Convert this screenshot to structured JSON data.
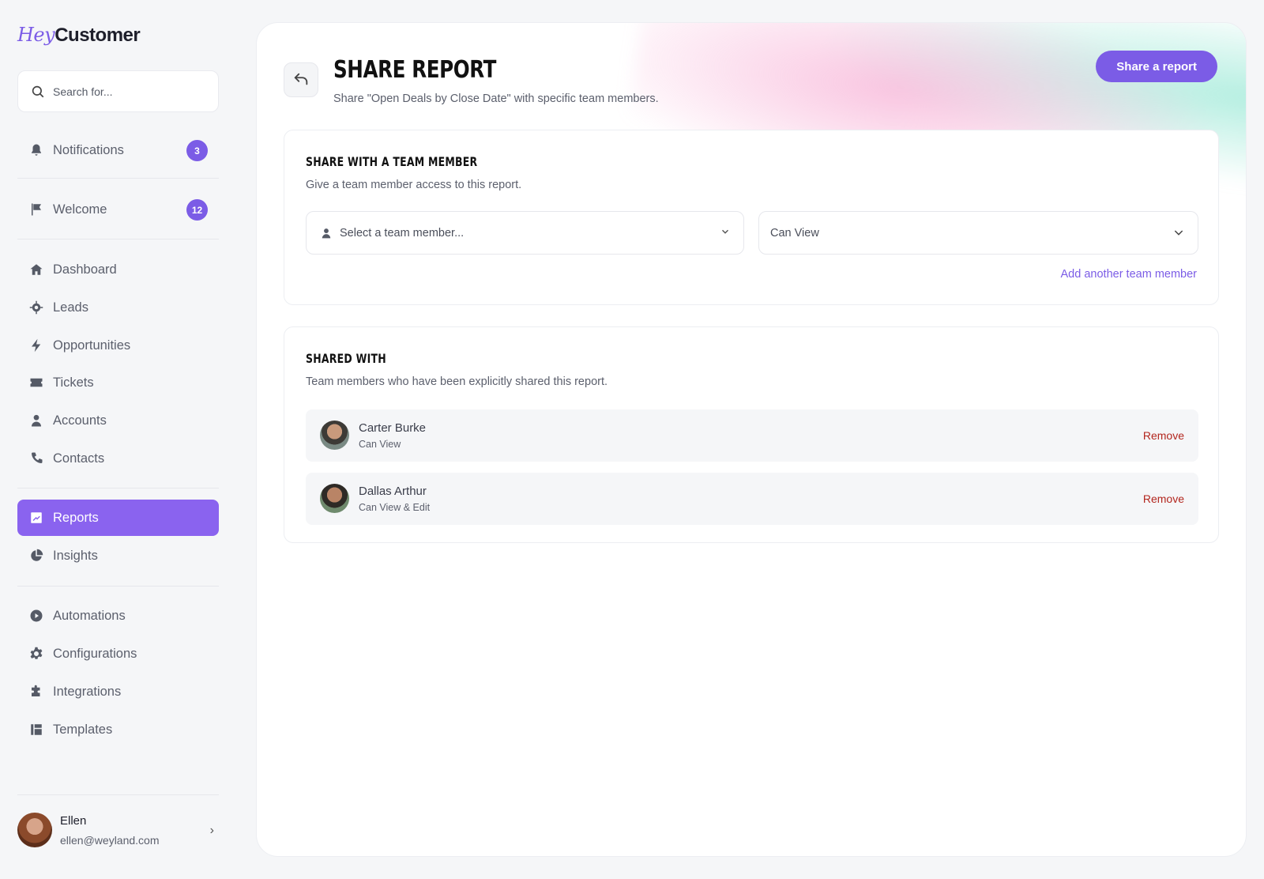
{
  "brand": {
    "prefix": "Hey",
    "name": "Customer"
  },
  "search": {
    "placeholder": "Search for..."
  },
  "sidebar": {
    "notifications": {
      "label": "Notifications",
      "badge": "3"
    },
    "welcome": {
      "label": "Welcome",
      "badge": "12"
    },
    "items": [
      {
        "label": "Dashboard",
        "icon": "home-icon"
      },
      {
        "label": "Leads",
        "icon": "target-icon"
      },
      {
        "label": "Opportunities",
        "icon": "bolt-icon"
      },
      {
        "label": "Tickets",
        "icon": "ticket-icon"
      },
      {
        "label": "Accounts",
        "icon": "user-icon"
      },
      {
        "label": "Contacts",
        "icon": "phone-icon"
      },
      {
        "label": "Reports",
        "icon": "chart-icon",
        "active": true
      },
      {
        "label": "Insights",
        "icon": "pie-icon"
      },
      {
        "label": "Automations",
        "icon": "play-icon"
      },
      {
        "label": "Configurations",
        "icon": "gear-icon"
      },
      {
        "label": "Integrations",
        "icon": "puzzle-icon"
      },
      {
        "label": "Templates",
        "icon": "template-icon"
      }
    ]
  },
  "user": {
    "name": "Ellen",
    "email": "ellen@weyland.com"
  },
  "header": {
    "title": "SHARE REPORT",
    "subtitle": "Share \"Open Deals by Close Date\" with specific team members.",
    "share_button": "Share a report"
  },
  "share_panel": {
    "title": "SHARE WITH A TEAM MEMBER",
    "description": "Give a team member access to this report.",
    "member_placeholder": "Select a team member...",
    "permission_value": "Can View",
    "add_link": "Add another team member"
  },
  "shared_panel": {
    "title": "SHARED WITH",
    "description": "Team members who have been explicitly shared this report.",
    "members": [
      {
        "name": "Carter Burke",
        "role": "Can View",
        "action": "Remove"
      },
      {
        "name": "Dallas Arthur",
        "role": "Can View & Edit",
        "action": "Remove"
      }
    ]
  },
  "colors": {
    "accent": "#7b5ce6",
    "danger": "#b3261e"
  }
}
